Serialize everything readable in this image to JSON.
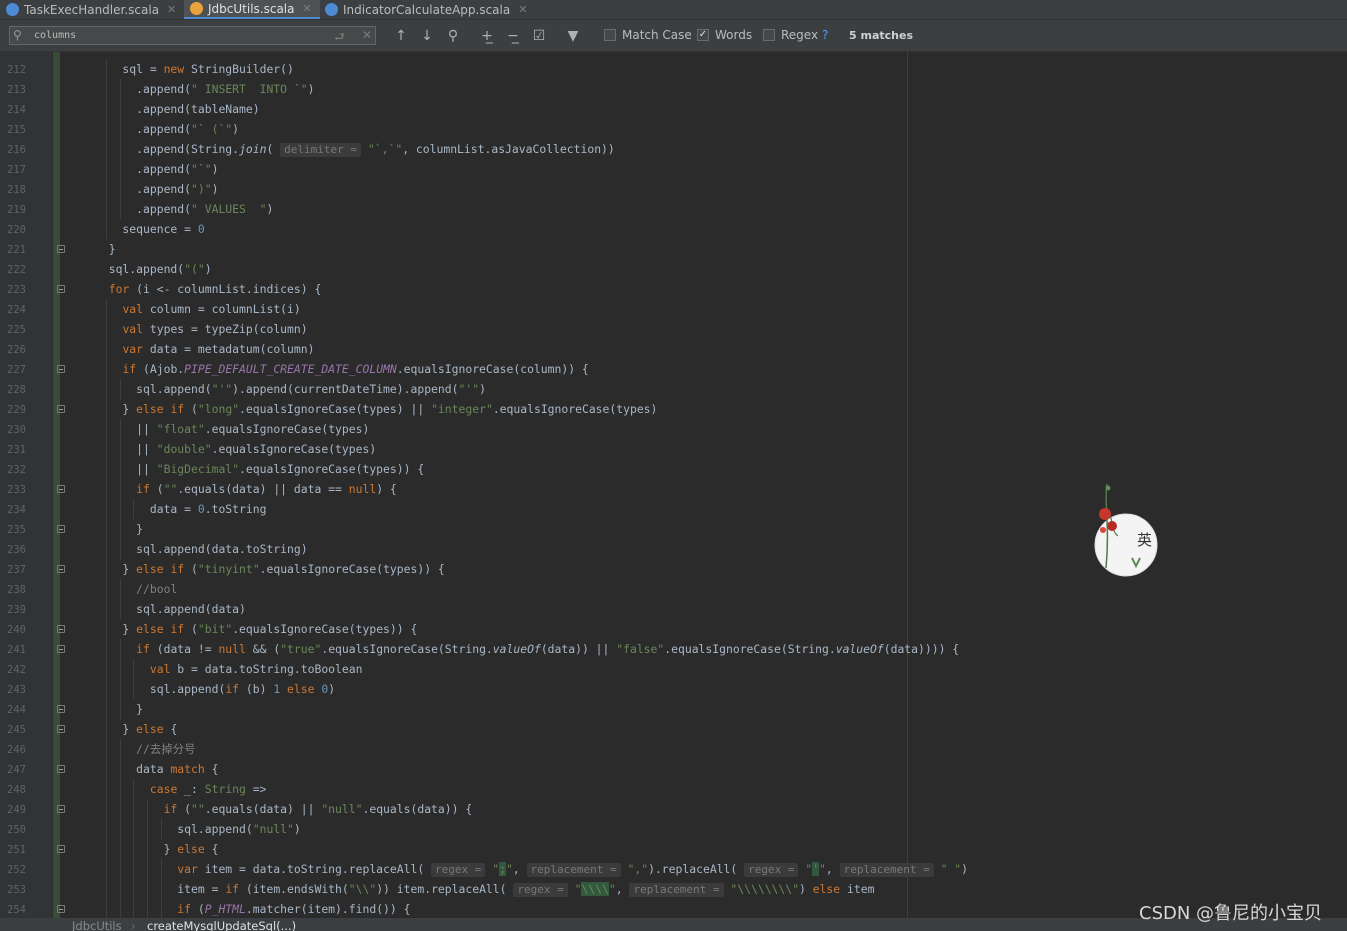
{
  "tabs": [
    {
      "label": "TaskExecHandler.scala",
      "active": false
    },
    {
      "label": "JdbcUtils.scala",
      "active": true
    },
    {
      "label": "IndicatorCalculateApp.scala",
      "active": false
    }
  ],
  "find": {
    "query": "columns",
    "match_case_label": "Match Case",
    "match_case_checked": false,
    "words_label": "Words",
    "words_checked": true,
    "regex_label": "Regex",
    "help": "?",
    "match_count": "5 matches"
  },
  "lines": [
    {
      "n": "212",
      "fold": false,
      "html": "    sql = <span class=\"k\">new</span> StringBuilder()"
    },
    {
      "n": "213",
      "fold": false,
      "html": "      .append(<span class=\"s\">\" INSERT  INTO `\"</span>)"
    },
    {
      "n": "214",
      "fold": false,
      "html": "      .append(tableName)"
    },
    {
      "n": "215",
      "fold": false,
      "html": "      .append(<span class=\"s\">\"` (`\"</span>)"
    },
    {
      "n": "216",
      "fold": false,
      "html": "      .append(String.<span class=\"it\">join</span>( <span class=\"ph\">delimiter =</span> <span class=\"s\">\"`,`\"</span>, columnList.asJavaCollection))"
    },
    {
      "n": "217",
      "fold": false,
      "html": "      .append(<span class=\"s\">\"`\"</span>)"
    },
    {
      "n": "218",
      "fold": false,
      "html": "      .append(<span class=\"s\">\")\"</span>)"
    },
    {
      "n": "219",
      "fold": false,
      "html": "      .append(<span class=\"s\">\" VALUES  \"</span>)"
    },
    {
      "n": "220",
      "fold": false,
      "html": "    sequence = <span class=\"n\">0</span>"
    },
    {
      "n": "221",
      "fold": true,
      "html": "  }"
    },
    {
      "n": "222",
      "fold": false,
      "html": "  sql.append(<span class=\"s\">\"(\"</span>)"
    },
    {
      "n": "223",
      "fold": true,
      "html": "  <span class=\"k\">for</span> (i &lt;- columnList.indices) {"
    },
    {
      "n": "224",
      "fold": false,
      "html": "    <span class=\"k\">val</span> column = columnList(i)"
    },
    {
      "n": "225",
      "fold": false,
      "html": "    <span class=\"k\">val</span> types = typeZip(column)"
    },
    {
      "n": "226",
      "fold": false,
      "html": "    <span class=\"k\">var</span> data = metadatum(column)"
    },
    {
      "n": "227",
      "fold": true,
      "html": "    <span class=\"k\">if</span> (Ajob.<span class=\"ic\">PIPE_DEFAULT_CREATE_DATE_COLUMN</span>.equalsIgnoreCase(column)) {"
    },
    {
      "n": "228",
      "fold": false,
      "html": "      sql.append(<span class=\"s\">\"'\"</span>).append(currentDateTime).append(<span class=\"s\">\"'\"</span>)"
    },
    {
      "n": "229",
      "fold": true,
      "html": "    } <span class=\"k\">else if</span> (<span class=\"s\">\"long\"</span>.equalsIgnoreCase(types) || <span class=\"s\">\"integer\"</span>.equalsIgnoreCase(types)"
    },
    {
      "n": "230",
      "fold": false,
      "html": "      || <span class=\"s\">\"float\"</span>.equalsIgnoreCase(types)"
    },
    {
      "n": "231",
      "fold": false,
      "html": "      || <span class=\"s\">\"double\"</span>.equalsIgnoreCase(types)"
    },
    {
      "n": "232",
      "fold": false,
      "html": "      || <span class=\"s\">\"BigDecimal\"</span>.equalsIgnoreCase(types)) {"
    },
    {
      "n": "233",
      "fold": true,
      "html": "      <span class=\"k\">if</span> (<span class=\"s\">\"\"</span>.equals(data) || data == <span class=\"k\">null</span>) {"
    },
    {
      "n": "234",
      "fold": false,
      "html": "        data = <span class=\"n\">0</span>.toString"
    },
    {
      "n": "235",
      "fold": true,
      "html": "      }"
    },
    {
      "n": "236",
      "fold": false,
      "html": "      sql.append(data.toString)"
    },
    {
      "n": "237",
      "fold": true,
      "html": "    } <span class=\"k\">else if</span> (<span class=\"s\">\"tinyint\"</span>.equalsIgnoreCase(types)) {"
    },
    {
      "n": "238",
      "fold": false,
      "html": "      <span class=\"c\">//bool</span>"
    },
    {
      "n": "239",
      "fold": false,
      "html": "      sql.append(data)"
    },
    {
      "n": "240",
      "fold": true,
      "html": "    } <span class=\"k\">else if</span> (<span class=\"s\">\"bit\"</span>.equalsIgnoreCase(types)) {"
    },
    {
      "n": "241",
      "fold": true,
      "html": "      <span class=\"k\">if</span> (data != <span class=\"k\">null</span> &amp;&amp; (<span class=\"s\">\"true\"</span>.equalsIgnoreCase(String.<span class=\"it\">valueOf</span>(data)) || <span class=\"s\">\"false\"</span>.equalsIgnoreCase(String.<span class=\"it\">valueOf</span>(data)))) {"
    },
    {
      "n": "242",
      "fold": false,
      "html": "        <span class=\"k\">val</span> b = data.toString.toBoolean"
    },
    {
      "n": "243",
      "fold": false,
      "html": "        sql.append(<span class=\"k\">if</span> (b) <span class=\"n\">1</span> <span class=\"k\">else</span> <span class=\"n\">0</span>)"
    },
    {
      "n": "244",
      "fold": true,
      "html": "      }"
    },
    {
      "n": "245",
      "fold": true,
      "html": "    } <span class=\"k\">else</span> {"
    },
    {
      "n": "246",
      "fold": false,
      "html": "      <span class=\"c\">//去掉分号</span>"
    },
    {
      "n": "247",
      "fold": true,
      "html": "      data <span class=\"k\">match</span> {"
    },
    {
      "n": "248",
      "fold": false,
      "html": "        <span class=\"k\">case</span> _: <span class=\"s\">String</span> =&gt;"
    },
    {
      "n": "249",
      "fold": true,
      "html": "          <span class=\"k\">if</span> (<span class=\"s\">\"\"</span>.equals(data) || <span class=\"s\">\"null\"</span>.equals(data)) {"
    },
    {
      "n": "250",
      "fold": false,
      "html": "            sql.append(<span class=\"s\">\"null\"</span>)"
    },
    {
      "n": "251",
      "fold": true,
      "html": "          } <span class=\"k\">else</span> {"
    },
    {
      "n": "252",
      "fold": false,
      "html": "            <span class=\"k\">var</span> item = data.toString.replaceAll( <span class=\"ph\">regex =</span> <span class=\"s\">\"<span class=\"hl\">;</span>\"</span>, <span class=\"ph\">replacement =</span> <span class=\"s\">\",\"</span>).replaceAll( <span class=\"ph\">regex =</span> <span class=\"s\">\"<span class=\"hl\">'</span>\"</span>, <span class=\"ph\">replacement =</span> <span class=\"s\">\" \"</span>)"
    },
    {
      "n": "253",
      "fold": false,
      "html": "            item = <span class=\"k\">if</span> (item.endsWith(<span class=\"s\">\"\\\\\"</span>)) item.replaceAll( <span class=\"ph\">regex =</span> <span class=\"s\">\"<span class=\"hl\">\\\\\\\\</span>\"</span>, <span class=\"ph\">replacement =</span> <span class=\"s\">\"\\\\\\\\\\\\\\\\\"</span>) <span class=\"k\">else</span> item"
    },
    {
      "n": "254",
      "fold": true,
      "html": "            <span class=\"k\">if</span> (<span class=\"ic\">P_HTML</span>.matcher(item).find()) {"
    }
  ],
  "breadcrumb": {
    "file": "JdbcUtils",
    "sep": "›",
    "method": "createMysqlUpdateSql(...)"
  },
  "watermark": "CSDN @鲁尼的小宝贝",
  "avatar_char": "英",
  "colors": {
    "keyword": "#cc7832",
    "string": "#6a8759",
    "number": "#6897bb",
    "comment": "#808080",
    "constant": "#9876aa",
    "text": "#a9b7c6"
  },
  "icons": [
    "scala-file-icon",
    "close-icon",
    "search-icon",
    "clear-icon",
    "arrow-up-icon",
    "arrow-down-icon",
    "find-all-icon",
    "add-selection-icon",
    "remove-selection-icon",
    "select-all-icon",
    "filter-icon"
  ]
}
